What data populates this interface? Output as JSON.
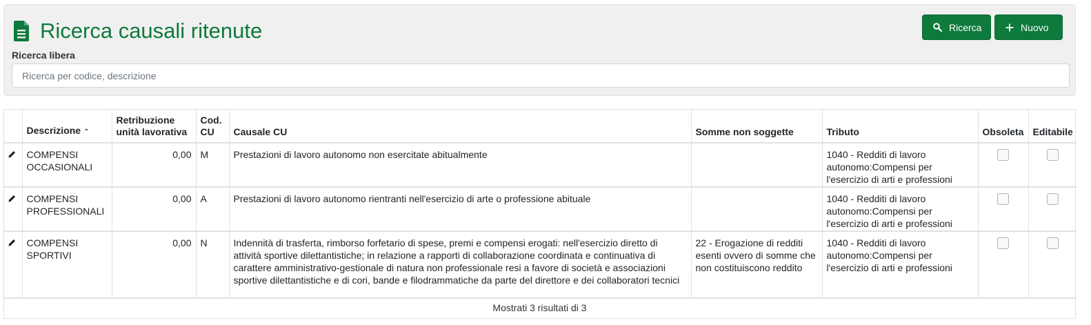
{
  "header": {
    "title": "Ricerca causali ritenute",
    "search_button": "Ricerca",
    "new_button": "Nuovo",
    "search_label": "Ricerca libera",
    "search_placeholder": "Ricerca per codice, descrizione",
    "search_value": ""
  },
  "table": {
    "columns": {
      "descrizione": "Descrizione",
      "retribuzione_1": "Retribuzione",
      "retribuzione_2": "unità lavorativa",
      "cod_1": "Cod.",
      "cod_2": "CU",
      "causale": "Causale CU",
      "somme": "Somme non soggette",
      "tributo": "Tributo",
      "obsoleta": "Obsoleta",
      "editabile": "Editabile"
    },
    "sort_indicator": "^",
    "rows": [
      {
        "descrizione": "COMPENSI OCCASIONALI",
        "retribuzione": "0,00",
        "cod_cu": "M",
        "causale": "Prestazioni di lavoro autonomo non esercitate abitualmente",
        "somme": "",
        "tributo": "1040 - Redditi di lavoro autonomo:Compensi per l'esercizio di arti e professioni",
        "obsoleta": false,
        "editabile": false
      },
      {
        "descrizione": "COMPENSI PROFESSIONALI",
        "retribuzione": "0,00",
        "cod_cu": "A",
        "causale": "Prestazioni di lavoro autonomo rientranti nell'esercizio di arte o professione abituale",
        "somme": "",
        "tributo": "1040 - Redditi di lavoro autonomo:Compensi per l'esercizio di arti e professioni",
        "obsoleta": false,
        "editabile": false
      },
      {
        "descrizione": "COMPENSI SPORTIVI",
        "retribuzione": "0,00",
        "cod_cu": "N",
        "causale": "Indennità di trasferta, rimborso forfetario di spese, premi e compensi erogati: nell'esercizio diretto di attività sportive dilettantistiche; in relazione a rapporti di collaborazione coordinata e continuativa di carattere amministrativo-gestionale di natura non professionale resi a favore di società e associazioni sportive dilettantistiche e di cori, bande e filodrammatiche da parte del direttore e dei collaboratori tecnici",
        "somme": "22 - Erogazione di redditi esenti ovvero di somme che non costituiscono reddito",
        "tributo": "1040 - Redditi di lavoro autonomo:Compensi per l'esercizio di arti e professioni",
        "obsoleta": false,
        "editabile": false
      }
    ],
    "footer": "Mostrati 3 risultati di 3"
  },
  "icons": {
    "title": "document-icon",
    "search": "search-icon",
    "new": "plus-icon",
    "edit": "pencil-icon"
  },
  "colors": {
    "brand": "#0e7a3c",
    "panel_bg": "#f0f0f0"
  }
}
